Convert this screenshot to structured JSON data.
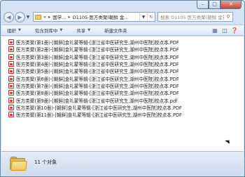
{
  "window": {
    "caption_buttons": {
      "minimize": "–",
      "maximize": "□",
      "close": "✕"
    }
  },
  "nav": {
    "back_icon": "back-arrow-icon",
    "forward_icon": "forward-arrow-icon",
    "address": {
      "overflow": "«",
      "crumbs": [
        "国学...",
        "D1105 医方类聚(朝鲜 金..."
      ],
      "separator": "▸"
    },
    "search_placeholder": "搜索 D1105 医方类聚(朝鲜 金礼蒙等...",
    "search_icon": "search-icon"
  },
  "toolbar": {
    "organize": "组织",
    "include_in_library": "包含到库中",
    "share": "共享",
    "new_folder": "新建文件夹",
    "dropdown_arrow": "▼"
  },
  "files": [
    "医方类聚(第1册)-[朝鲜]金礼蒙等辑-[浙江省中医研究生,湖州中医院]校点本.PDF",
    "医方类聚(第2册)-[朝鲜]金礼蒙等辑-[浙江省中医研究生,湖州中医院]校点本.PDF",
    "医方类聚(第3册)-[朝鲜]金礼蒙等辑-[浙江省中医研究生,湖州中医院]校点本.PDF",
    "医方类聚(第4册)-[朝鲜]金礼蒙等辑-[浙江省中医研究生,湖州中医院]校点本.PDF",
    "医方类聚(第5册)-[朝鲜]金礼蒙等辑-[浙江省中医研究生,湖州中医院]校点本.PDF",
    "医方类聚(第6册)-[朝鲜]金礼蒙等辑-[浙江省中医研究生,湖州中医院]校点本.PDF",
    "医方类聚(第7册)-[朝鲜]金礼蒙等辑-[浙江省中医研究生,湖州中医院]校点本.PDF",
    "医方类聚(第8册)-[朝鲜]金礼蒙等辑-[浙江省中医研究生,湖州中医院]校点本.PDF",
    "医方类聚(第9册)-[朝鲜]金礼蒙等辑-[浙江省中医研究生,湖州中医院]校点本.pdf",
    "医方类聚(第10册)-[朝鲜]金礼蒙等辑-[浙江省中医研究生,湖州中医院]校点本.PDF",
    "医方类聚(第11册)-[朝鲜]金礼蒙等辑-[浙江省中医研究生,湖州中医院]校点本.PDF"
  ],
  "status": {
    "item_count": "11 个对象"
  },
  "colors": {
    "frame": "#d5e3f2",
    "pdf_red": "#d63a3a",
    "folder_yellow": "#f0c65a"
  }
}
